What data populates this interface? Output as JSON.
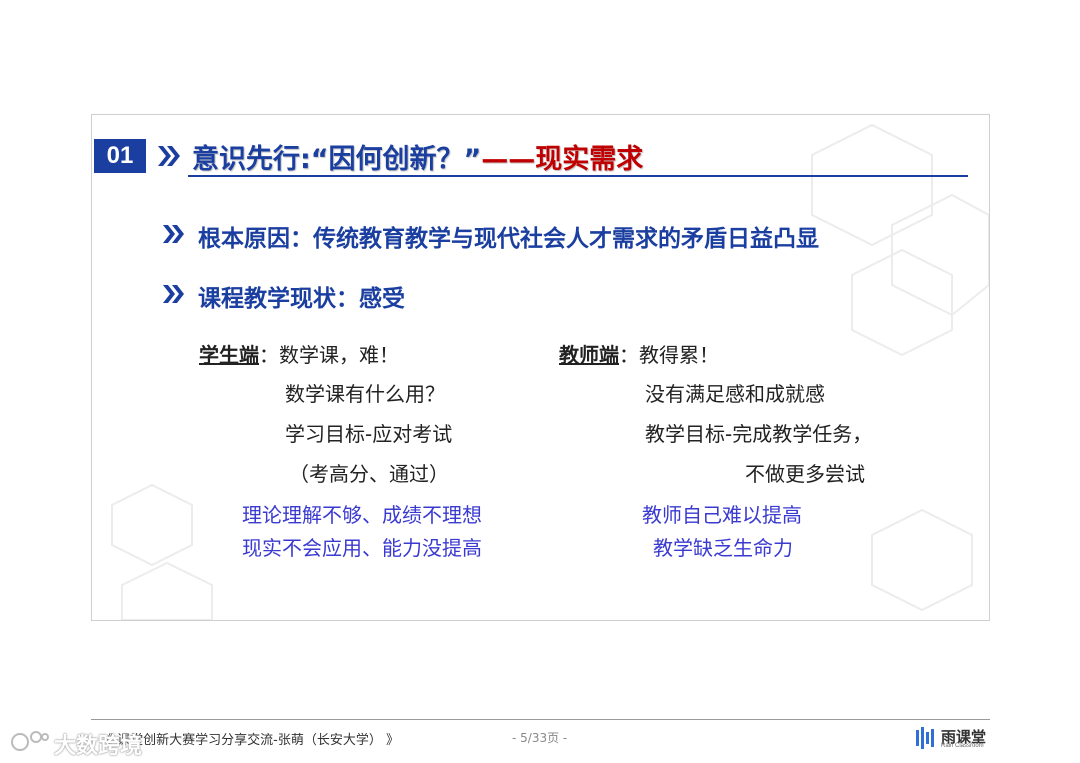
{
  "slide": {
    "number": "01",
    "title_part1": "意识先行:“因何创新？”",
    "title_part2": "——现实需求",
    "bullets": [
      "根本原因：传统教育教学与现代社会人才需求的矛盾日益凸显",
      "课程教学现状：感受"
    ],
    "student": {
      "label": "学生端",
      "line1": "：数学课，难！",
      "line2": "数学课有什么用？",
      "line3": "学习目标-应对考试",
      "line4": "（考高分、通过）",
      "blue1": "理论理解不够、成绩不理想",
      "blue2": "现实不会应用、能力没提高"
    },
    "teacher": {
      "label": "教师端",
      "line1": "：教得累！",
      "line2": "没有满足感和成就感",
      "line3": "教学目标-完成教学任务，",
      "line4": "不做更多尝试",
      "blue1": "教师自己难以提高",
      "blue2": "教学缺乏生命力"
    }
  },
  "footer": {
    "text": "《 课堂创新大赛学习分享交流-张萌（长安大学） 》",
    "page": "- 5/33页 -",
    "logo_name": "雨课堂",
    "logo_sub": "Rain Classroom",
    "watermark": "大数跨境"
  },
  "colors": {
    "accent": "#1b3fa0",
    "title_red": "#c00000",
    "blue_text": "#3a3ad0"
  }
}
